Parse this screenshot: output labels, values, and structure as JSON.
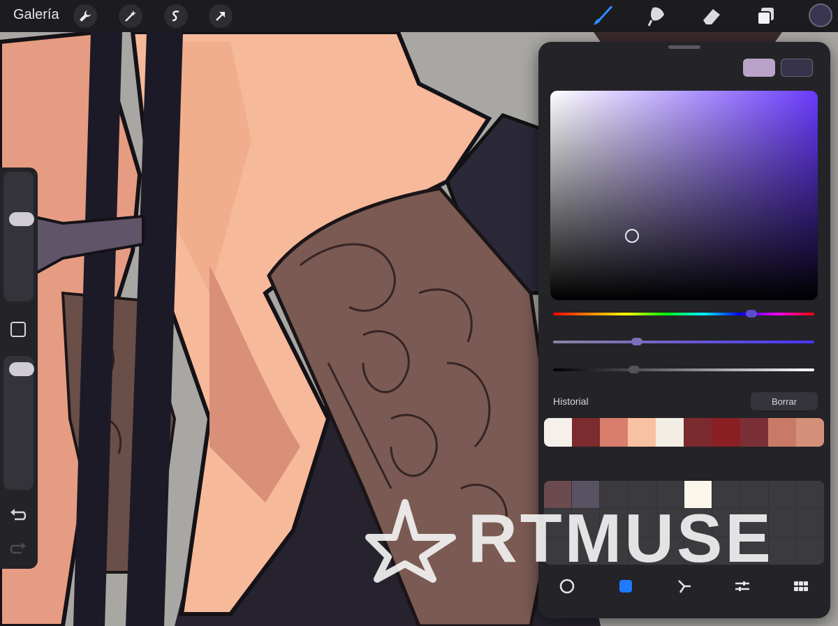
{
  "topbar": {
    "gallery_label": "Galería",
    "left_tools": [
      "wrench-icon",
      "magic-wand-icon",
      "selection-s-icon",
      "transform-arrow-icon"
    ],
    "right_tools": [
      "brush-icon",
      "smudge-icon",
      "eraser-icon",
      "layers-icon"
    ],
    "active_tool": "brush-icon",
    "current_color": "#3a3550"
  },
  "sidebar": {
    "size_slider_value": 0.35,
    "opacity_slider_value": 0.05,
    "modify_button_icon": "square-icon",
    "undo_icon": "undo-icon",
    "redo_icon": "redo-icon"
  },
  "color_panel": {
    "current_swatches": [
      "#b9a3c8",
      "#36334a"
    ],
    "hue_color": "#6a3bff",
    "hue_value": 0.76,
    "saturation_value": 0.32,
    "brightness_value": 0.31,
    "history_label": "Historial",
    "clear_label": "Borrar",
    "history_colors": [
      "#f5f1ea",
      "#7c2b2f",
      "#d97d6d",
      "#f8c1a2",
      "#f3eee5",
      "#7b2a2e",
      "#8a1f24",
      "#7a3036",
      "#c97a66",
      "#d4907a"
    ],
    "palette_colors": [
      "#6b4a50",
      "#595262",
      "#3b3a3f",
      "#3b3a3f",
      "#3b3a3f",
      "#faf6ea",
      "#3b3a3f",
      "#3b3a3f",
      "#3b3a3f",
      "#3b3a3f"
    ],
    "tabs": [
      "disc-icon",
      "classic-icon",
      "harmony-icon",
      "values-icon",
      "palettes-icon"
    ],
    "active_tab": "classic-icon"
  },
  "watermark": "ARTMUSE"
}
